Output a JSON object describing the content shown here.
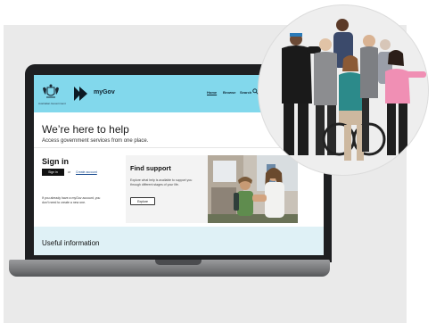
{
  "site": {
    "crest_caption": "Australian Government",
    "logo_label": "myGov",
    "nav": {
      "home": "Home",
      "browse": "Browse",
      "search": "Search"
    },
    "hero": {
      "title": "We’re here to help",
      "subtitle": "Access government services from one place."
    },
    "signin": {
      "title": "Sign in",
      "button": "Sign in",
      "or": "or",
      "create_link": "Create account",
      "no_account_text": "If you already have a myGov account, you don’t need to create a new one."
    },
    "support": {
      "title": "Find support",
      "description": "Explore what help is available to support you through different stages of your life.",
      "button": "Explore"
    },
    "useful": {
      "title": "Useful information"
    }
  },
  "colors": {
    "header_bg": "#82d8ec",
    "laptop_bezel": "#1e1f21",
    "panel_bg": "#eaeaea",
    "useful_bg": "#dff1f6"
  },
  "icons": [
    "coat-of-arms-icon",
    "mygov-logo-icon",
    "search-icon"
  ]
}
